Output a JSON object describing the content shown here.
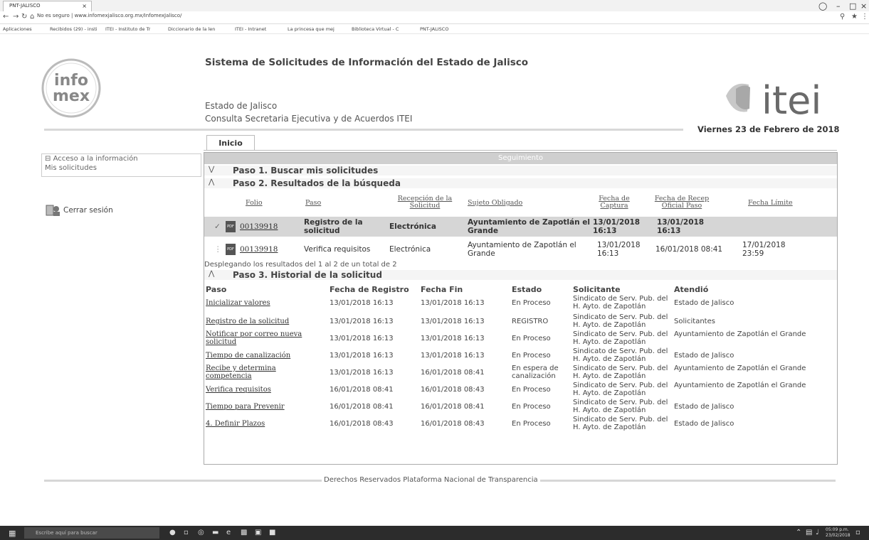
{
  "browser": {
    "tab_title": "PNT-JALISCO",
    "tab_close": "×",
    "url_warning": "No es seguro",
    "url": "www.infomexjalisco.org.mx/InfomexJalisco/",
    "bookmarks": [
      "Aplicaciones",
      "Recibidos (29) - insti",
      "ITEI - Instituto de Tr",
      "Diccionario de la len",
      "ITEI - Intranet",
      "La princesa que mej",
      "Biblioteca Virtual - C",
      "PNT-JALISCO"
    ]
  },
  "header": {
    "logo_text": "infomex",
    "site_title": "Sistema de Solicitudes de Información del Estado de Jalisco",
    "estado": "Estado de Jalisco",
    "consulta": "Consulta Secretaria Ejecutiva y de Acuerdos ITEI",
    "itei_logo": "itei",
    "fecha": "Viernes 23 de Febrero de 2018"
  },
  "tabs": {
    "inicio": "Inicio"
  },
  "leftmenu": {
    "items": [
      "Acceso a la información",
      "Mis solicitudes"
    ],
    "cerrar": "Cerrar sesión"
  },
  "panel": {
    "seguimiento": "Seguimiento",
    "paso1": "Paso 1. Buscar mis solicitudes",
    "paso2": "Paso 2. Resultados de la búsqueda",
    "paso3": "Paso 3. Historial de la solicitud",
    "results_headers": [
      "Folio",
      "Paso",
      "Recepción de la Solicitud",
      "Sujeto Obligado",
      "Fecha de Captura",
      "Fecha de Recep Oficial Paso",
      "Fecha Límite"
    ],
    "results": [
      {
        "folio": "00139918",
        "paso": "Registro de la solicitud",
        "recepcion": "Electrónica",
        "sujeto": "Ayuntamiento de Zapotlán el Grande",
        "captura": "13/01/2018 16:13",
        "recep_oficial": "13/01/2018 16:13",
        "limite": ""
      },
      {
        "folio": "00139918",
        "paso": "Verifica requisitos",
        "recepcion": "Electrónica",
        "sujeto": "Ayuntamiento de Zapotlán el Grande",
        "captura": "13/01/2018 16:13",
        "recep_oficial": "16/01/2018 08:41",
        "limite": "17/01/2018 23:59"
      }
    ],
    "desplegando": "Desplegando los resultados del 1 al 2 de un total de 2",
    "history_headers": [
      "Paso",
      "Fecha de Registro",
      "Fecha Fin",
      "Estado",
      "Solicitante",
      "Atendió"
    ],
    "history": [
      {
        "paso": "Inicializar valores",
        "registro": "13/01/2018 16:13",
        "fin": "13/01/2018 16:13",
        "estado": "En Proceso",
        "solicitante": "Sindicato de Serv. Pub. del H. Ayto. de Zapotlán",
        "atendio": "Estado de Jalisco"
      },
      {
        "paso": "Registro de la solicitud",
        "registro": "13/01/2018 16:13",
        "fin": "13/01/2018 16:13",
        "estado": "REGISTRO",
        "solicitante": "Sindicato de Serv. Pub. del H. Ayto. de Zapotlán",
        "atendio": "Solicitantes"
      },
      {
        "paso": "Notificar por correo nueva solicitud",
        "registro": "13/01/2018 16:13",
        "fin": "13/01/2018 16:13",
        "estado": "En Proceso",
        "solicitante": "Sindicato de Serv. Pub. del H. Ayto. de Zapotlán",
        "atendio": "Ayuntamiento de Zapotlán el Grande"
      },
      {
        "paso": "Tiempo de canalización",
        "registro": "13/01/2018 16:13",
        "fin": "13/01/2018 16:13",
        "estado": "En Proceso",
        "solicitante": "Sindicato de Serv. Pub. del H. Ayto. de Zapotlán",
        "atendio": "Estado de Jalisco"
      },
      {
        "paso": "Recibe y determina competencia",
        "registro": "13/01/2018 16:13",
        "fin": "16/01/2018 08:41",
        "estado": "En espera de canalización",
        "solicitante": "Sindicato de Serv. Pub. del H. Ayto. de Zapotlán",
        "atendio": "Ayuntamiento de Zapotlán el Grande"
      },
      {
        "paso": "Verifica requisitos",
        "registro": "16/01/2018 08:41",
        "fin": "16/01/2018 08:43",
        "estado": "En Proceso",
        "solicitante": "Sindicato de Serv. Pub. del H. Ayto. de Zapotlán",
        "atendio": "Ayuntamiento de Zapotlán el Grande"
      },
      {
        "paso": "Tiempo para Prevenir",
        "registro": "16/01/2018 08:41",
        "fin": "16/01/2018 08:41",
        "estado": "En Proceso",
        "solicitante": "Sindicato de Serv. Pub. del H. Ayto. de Zapotlán",
        "atendio": "Estado de Jalisco"
      },
      {
        "paso": "4. Definir Plazos",
        "registro": "16/01/2018 08:43",
        "fin": "16/01/2018 08:43",
        "estado": "En Proceso",
        "solicitante": "Sindicato de Serv. Pub. del H. Ayto. de Zapotlán",
        "atendio": "Estado de Jalisco"
      }
    ]
  },
  "footer": "Derechos Reservados Plataforma Nacional de Transparencia",
  "taskbar": {
    "search": "Escribe aquí para buscar",
    "time": "05:09 p.m.",
    "date": "23/02/2018"
  }
}
